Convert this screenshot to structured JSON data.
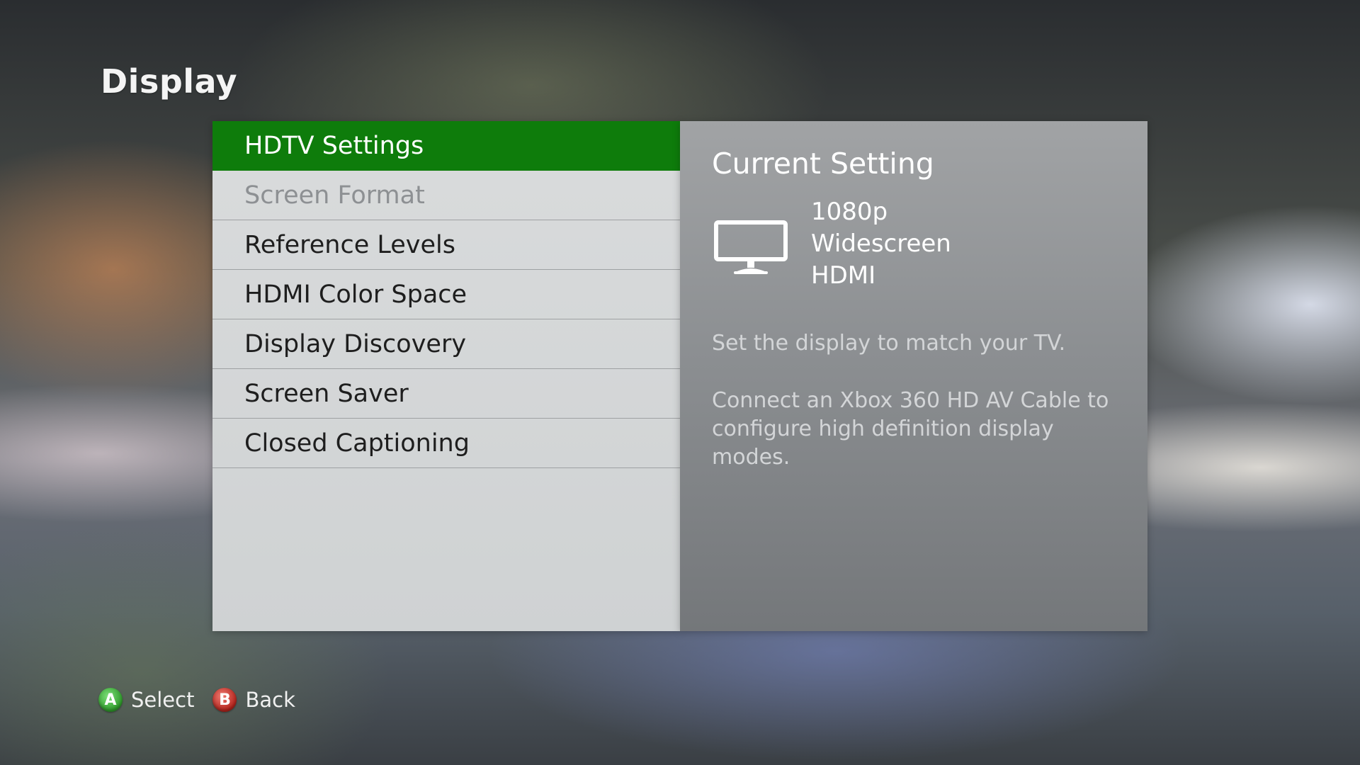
{
  "page": {
    "title": "Display"
  },
  "menu": {
    "items": [
      {
        "label": "HDTV Settings",
        "state": "selected"
      },
      {
        "label": "Screen Format",
        "state": "disabled"
      },
      {
        "label": "Reference Levels",
        "state": "normal"
      },
      {
        "label": "HDMI Color Space",
        "state": "normal"
      },
      {
        "label": "Display Discovery",
        "state": "normal"
      },
      {
        "label": "Screen Saver",
        "state": "normal"
      },
      {
        "label": "Closed Captioning",
        "state": "normal"
      }
    ]
  },
  "info": {
    "heading": "Current Setting",
    "icon": "tv-icon",
    "values": [
      "1080p",
      "Widescreen",
      "HDMI"
    ],
    "description_1": "Set the display to match your TV.",
    "description_2": "Connect an Xbox 360 HD AV Cable to configure high definition display modes."
  },
  "footer": {
    "a_button": "A",
    "a_label": "Select",
    "b_button": "B",
    "b_label": "Back"
  },
  "colors": {
    "selected": "#0e7c0b",
    "a_button": "#2e9a2a",
    "b_button": "#b3231b"
  }
}
